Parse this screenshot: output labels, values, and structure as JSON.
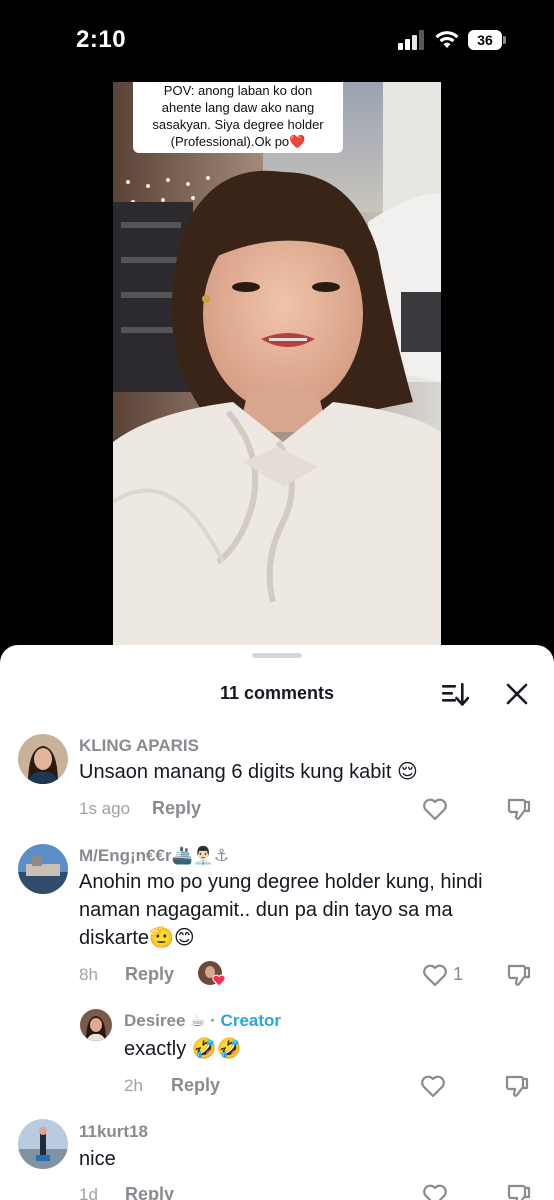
{
  "status_bar": {
    "time": "2:10",
    "battery": "36"
  },
  "video": {
    "caption_lines": [
      "POV: anong laban ko don",
      "ahente lang daw ako nang",
      "sasakyan. Siya degree holder",
      "(Professional).Ok po"
    ],
    "caption_heart": "❤️"
  },
  "sheet": {
    "title": "11 comments"
  },
  "comments": [
    {
      "username": "KLING APARIS",
      "text": "Unsaon manang 6 digits kung kabit 😌",
      "time": "1s ago",
      "reply_label": "Reply"
    },
    {
      "username": "M/Eng¡n€€r🚢👨🏻‍💼⚓",
      "text_lines": [
        "Anohin mo po yung degree holder kung, hindi",
        "naman nagagamit.. dun pa din tayo sa ma",
        "diskarte🫡😊"
      ],
      "time": "8h",
      "reply_label": "Reply",
      "likes": "1"
    },
    {
      "username": "Desiree ☕",
      "separator": "·",
      "creator_label": "Creator",
      "text": "exactly 🤣🤣",
      "time": "2h",
      "reply_label": "Reply"
    },
    {
      "username": "11kurt18",
      "text": "nice",
      "time": "1d",
      "reply_label": "Reply"
    }
  ],
  "colors": {
    "accent_creator": "#2aa6d8",
    "like_heart": "#fe2c55"
  }
}
